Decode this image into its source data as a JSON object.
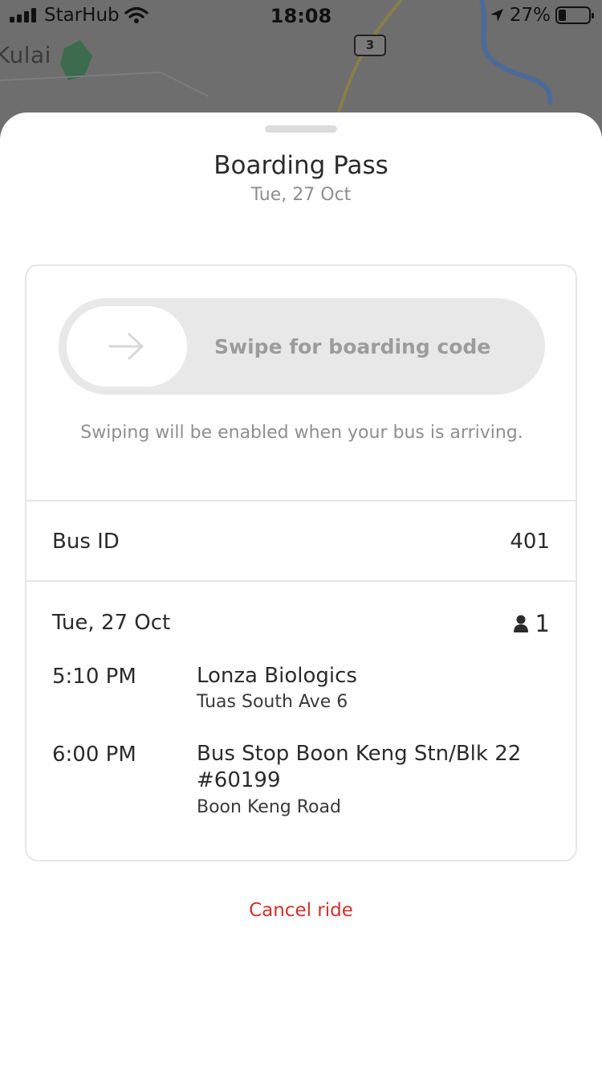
{
  "status_bar": {
    "carrier": "StarHub",
    "time": "18:08",
    "battery": "27%",
    "battery_level": 0.27,
    "icons": [
      "signal-icon",
      "wifi-icon",
      "location-arrow-icon",
      "battery-icon"
    ]
  },
  "map": {
    "place_label": "Kulai",
    "road_number": "3"
  },
  "sheet": {
    "title": "Boarding Pass",
    "date": "Tue, 27 Oct"
  },
  "card": {
    "swipe_label": "Swipe for boarding code",
    "swipe_note": "Swiping will be enabled when your bus is arriving.",
    "bus_id_label": "Bus ID",
    "bus_id_value": "401",
    "trip_date": "Tue, 27 Oct",
    "passenger_count": "1",
    "stops": [
      {
        "time": "5:10 PM",
        "name": "Lonza Biologics",
        "road": "Tuas South Ave 6"
      },
      {
        "time": "6:00 PM",
        "name": "Bus Stop Boon Keng Stn/Blk 22 #60199",
        "road": "Boon Keng Road"
      }
    ]
  },
  "actions": {
    "cancel_label": "Cancel ride"
  },
  "colors": {
    "accent_red": "#d0312d",
    "muted_text": "#8e8e8e",
    "track": "#e8e8e8"
  }
}
